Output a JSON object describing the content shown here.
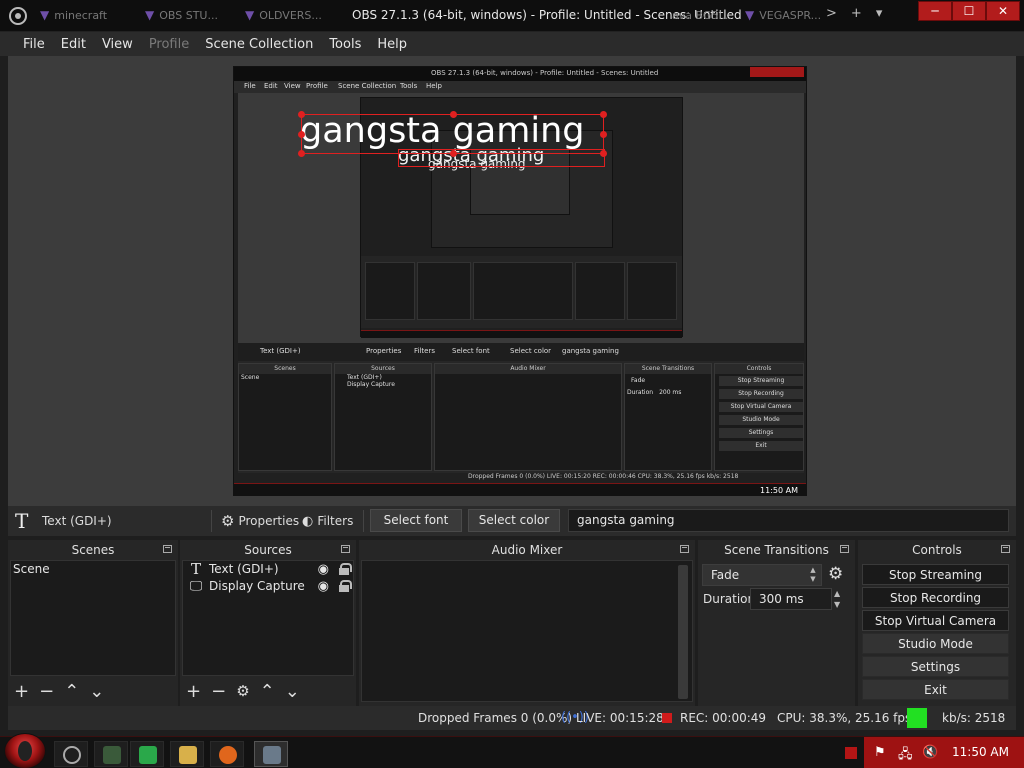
{
  "titlebar": {
    "tabs": [
      {
        "label": "minecraft"
      },
      {
        "label": "OBS STU..."
      },
      {
        "label": "OLDVERS..."
      }
    ],
    "right_tabs": [
      {
        "label": "ava BG5l..."
      },
      {
        "label": "VEGASPR..."
      }
    ],
    "window_title": "OBS 27.1.3 (64-bit, windows) - Profile: Untitled - Scenes: Untitled",
    "nav_symbols": [
      ">",
      "+",
      "▾"
    ]
  },
  "menu": {
    "items": [
      "File",
      "Edit",
      "View",
      "Profile",
      "Scene Collection",
      "Tools",
      "Help"
    ]
  },
  "preview": {
    "overlay_text": "gangsta gaming",
    "mini_window_title": "OBS 27.1.3 (64-bit, windows) - Profile: Untitled - Scenes: Untitled",
    "mini_menu": [
      "File",
      "Edit",
      "View",
      "Profile",
      "Scene Collection",
      "Tools",
      "Help"
    ],
    "mini_source_name": "Text (GDI+)",
    "mini_properties": "Properties",
    "mini_filters": "Filters",
    "mini_select_font": "Select font",
    "mini_select_color": "Select color",
    "mini_text_value": "gangsta gaming",
    "mini_docks": [
      "Scenes",
      "Sources",
      "Audio Mixer",
      "Scene Transitions",
      "Controls"
    ],
    "mini_scene": "Scene",
    "mini_sources": [
      "Text (GDI+)",
      "Display Capture"
    ],
    "mini_transition": "Fade",
    "mini_duration_label": "Duration",
    "mini_duration": "200 ms",
    "mini_controls": [
      "Stop Streaming",
      "Stop Recording",
      "Stop Virtual Camera",
      "Studio Mode",
      "Settings",
      "Exit"
    ],
    "mini_status": "Dropped Frames 0 (0.0%)   LIVE: 00:15:20   REC: 00:00:46   CPU: 38.3%, 25.16 fps   kb/s: 2518",
    "mini_clock": "11:50 AM"
  },
  "source_toolbar": {
    "source_name": "Text (GDI+)",
    "properties_label": "Properties",
    "filters_label": "Filters",
    "select_font_label": "Select font",
    "select_color_label": "Select color",
    "text_value": "gangsta gaming"
  },
  "scenes_dock": {
    "title": "Scenes",
    "items": [
      "Scene"
    ]
  },
  "sources_dock": {
    "title": "Sources",
    "items": [
      {
        "label": "Text (GDI+)",
        "icon": "text-icon"
      },
      {
        "label": "Display Capture",
        "icon": "monitor-icon"
      }
    ]
  },
  "mixer_dock": {
    "title": "Audio Mixer"
  },
  "transitions_dock": {
    "title": "Scene Transitions",
    "transition": "Fade",
    "duration_label": "Duration",
    "duration": "300 ms"
  },
  "controls_dock": {
    "title": "Controls",
    "buttons": [
      "Stop Streaming",
      "Stop Recording",
      "Stop Virtual Camera",
      "Studio Mode",
      "Settings",
      "Exit"
    ]
  },
  "status": {
    "dropped_frames": "Dropped Frames 0 (0.0%)",
    "live": "LIVE: 00:15:28",
    "rec": "REC: 00:00:49",
    "cpu": "CPU: 38.3%, 25.16 fps",
    "kbps": "kb/s: 2518"
  },
  "taskbar": {
    "clock": "11:50 AM"
  },
  "colors": {
    "accent_red": "#b21c1c",
    "live_blue": "#3f6fd6",
    "rec_red": "#d01b1b",
    "perf_green": "#22e022"
  }
}
